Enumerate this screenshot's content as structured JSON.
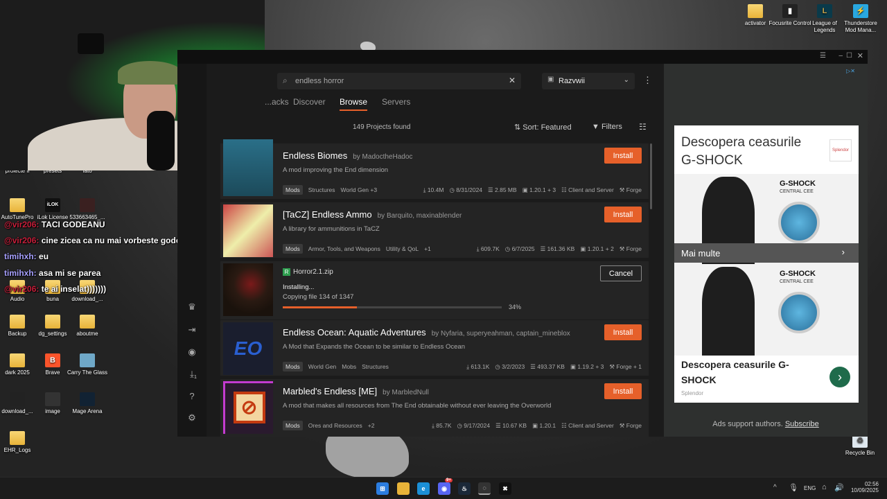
{
  "stream": {
    "chat": [
      {
        "user": "@vir206:",
        "text": "TACI GODEANU",
        "mention": true
      },
      {
        "user": "@vir206:",
        "text": "cine zicea ca nu mai vorbeste godeanu mult",
        "mention": true
      },
      {
        "user": "timihxh:",
        "text": "eu",
        "mention": false
      },
      {
        "user": "timihxh:",
        "text": "asa mi se parea",
        "mention": false
      },
      {
        "user": "@vir206:",
        "text": "te ai inselat)))))))",
        "mention": true
      }
    ]
  },
  "desktop": {
    "icons_right": [
      "activator",
      "Focusrite Control",
      "League of Legends",
      "Thunderstore Mod Mana..."
    ],
    "icons_left": [
      {
        "label": "proiecte fl",
        "icon": "folder"
      },
      {
        "label": "presets",
        "icon": "folder"
      },
      {
        "label": "fato",
        "icon": "folder"
      },
      {
        "label": "AutoTunePro",
        "icon": "folder"
      },
      {
        "label": "iLok License",
        "icon": "app"
      },
      {
        "label": "533663465_...",
        "icon": "image"
      },
      {
        "label": "Audio",
        "icon": "folder"
      },
      {
        "label": "buna",
        "icon": "folder"
      },
      {
        "label": "download_...",
        "icon": "folder"
      },
      {
        "label": "Backup",
        "icon": "folder"
      },
      {
        "label": "dg_settings",
        "icon": "folder"
      },
      {
        "label": "aboutme",
        "icon": "folder"
      },
      {
        "label": "dark 2025",
        "icon": "folder"
      },
      {
        "label": "Brave",
        "icon": "app"
      },
      {
        "label": "Carry The Glass",
        "icon": "app"
      },
      {
        "label": "download_...",
        "icon": "image"
      },
      {
        "label": "image",
        "icon": "image"
      },
      {
        "label": "Mage Arena",
        "icon": "app"
      },
      {
        "label": "EHR_Logs",
        "icon": "folder"
      }
    ],
    "recycle_bin": "Recycle Bin"
  },
  "app": {
    "search_value": "endless horror",
    "profile_name": "Razvwii",
    "tabs": [
      "...acks",
      "Discover",
      "Browse",
      "Servers"
    ],
    "active_tab": "Browse",
    "projects_found": "149 Projects found",
    "sort_label": "Sort: Featured",
    "filters_label": "Filters",
    "downloads_badge": "1",
    "install_label": "Install",
    "cancel_label": "Cancel",
    "mods": [
      {
        "title": "Endless Biomes",
        "author": "by MadoctheHadoc",
        "description": "A mod improving the End dimension",
        "tags": [
          "Mods",
          "Structures",
          "World Gen",
          "+3"
        ],
        "downloads": "10.4M",
        "date": "8/31/2024",
        "size": "2.85 MB",
        "version": "1.20.1 + 3",
        "env": "Client and Server",
        "loader": "Forge"
      },
      {
        "title": "[TaCZ] Endless Ammo",
        "author": "by Barquito, maxinablender",
        "description": "A library for ammunitions in TaCZ",
        "tags": [
          "Mods",
          "Armor, Tools, and Weapons",
          "Utility & QoL",
          "+1"
        ],
        "downloads": "609.7K",
        "date": "6/7/2025",
        "size": "161.36 KB",
        "version": "1.20.1 + 2",
        "env": "",
        "loader": "Forge"
      },
      {
        "title": "Endless Ocean: Aquatic Adventures",
        "author": "by Nyfaria, superyeahman, captain_mineblox",
        "description": "A Mod that Expands the Ocean to be similar to Endless Ocean",
        "tags": [
          "Mods",
          "World Gen",
          "Mobs",
          "Structures"
        ],
        "downloads": "613.1K",
        "date": "3/2/2023",
        "size": "493.37 KB",
        "version": "1.19.2 + 3",
        "env": "",
        "loader": "Forge + 1"
      },
      {
        "title": "Marbled's Endless [ME]",
        "author": "by MarbledNull",
        "description": "A mod that makes all resources from The End obtainable without ever leaving the Overworld",
        "tags": [
          "Mods",
          "Ores and Resources",
          "+2"
        ],
        "downloads": "85.7K",
        "date": "9/17/2024",
        "size": "10.67 KB",
        "version": "1.20.1",
        "env": "Client and Server",
        "loader": "Forge"
      }
    ],
    "download": {
      "file": "Horror2.1.zip",
      "status": "Installing...",
      "detail": "Copying file 134 of 1347",
      "progress": 0.34,
      "percent_text": "34%"
    },
    "ad": {
      "headline": "Descopera ceasurile G-SHOCK",
      "brand": "Splendor",
      "watch_brand": "G-SHOCK",
      "sub": "CENTRAL CEE",
      "more": "Mai multe",
      "headline2": "Descopera ceasurile G-SHOCK",
      "footer_brand": "Splendor",
      "support_text": "Ads support authors.",
      "subscribe": "Subscribe"
    }
  },
  "taskbar": {
    "lang": "ENG",
    "time": "02:56",
    "date": "10/09/2025",
    "discord_badge": "9+"
  },
  "colors": {
    "accent": "#e6602a",
    "card": "#242424",
    "bg": "#1b1b1b"
  }
}
